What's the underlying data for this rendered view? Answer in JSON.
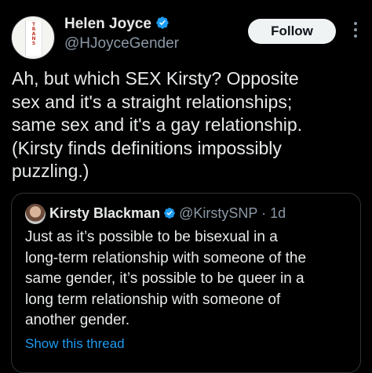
{
  "tweet": {
    "author": {
      "display_name": "Helen Joyce",
      "handle": "@HJoyceGender",
      "verified": true,
      "avatar_book_letters": "T\nR\nA\nN\nS"
    },
    "follow_label": "Follow",
    "more_icon": "more-horizontal-icon",
    "text": "Ah, but which SEX Kirsty? Opposite\nsex and it's a straight relationships;\nsame sex and it's a gay relationship.\n(Kirsty finds definitions impossibly\npuzzling.)"
  },
  "quote": {
    "author": {
      "display_name": "Kirsty Blackman",
      "handle": "@KirstySNP",
      "separator": "·",
      "time": "1d",
      "verified": true
    },
    "text": "Just as it’s possible to be bisexual in a\nlong-term relationship with someone of the\nsame gender, it’s possible to be queer in a\nlong term relationship with someone of\nanother gender.",
    "show_thread_label": "Show this thread"
  },
  "colors": {
    "background": "#000000",
    "text_primary": "#e7e9ea",
    "text_secondary": "#8b98a5",
    "link": "#1d9bf0",
    "verified_badge": "#1d9bf0",
    "follow_button_bg": "#eff3f4",
    "border": "#2f3336"
  }
}
